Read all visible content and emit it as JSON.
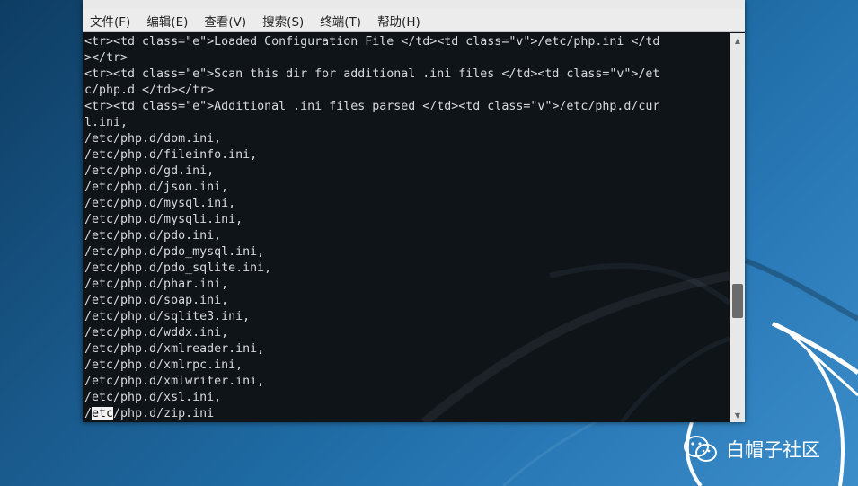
{
  "menubar": {
    "items": [
      "文件(F)",
      "编辑(E)",
      "查看(V)",
      "搜索(S)",
      "终端(T)",
      "帮助(H)"
    ]
  },
  "terminal": {
    "lines": [
      "<tr><td class=\"e\">Loaded Configuration File </td><td class=\"v\">/etc/php.ini </td",
      "></tr>",
      "<tr><td class=\"e\">Scan this dir for additional .ini files </td><td class=\"v\">/et",
      "c/php.d </td></tr>",
      "<tr><td class=\"e\">Additional .ini files parsed </td><td class=\"v\">/etc/php.d/cur",
      "l.ini,",
      "/etc/php.d/dom.ini,",
      "/etc/php.d/fileinfo.ini,",
      "/etc/php.d/gd.ini,",
      "/etc/php.d/json.ini,",
      "/etc/php.d/mysql.ini,",
      "/etc/php.d/mysqli.ini,",
      "/etc/php.d/pdo.ini,",
      "/etc/php.d/pdo_mysql.ini,",
      "/etc/php.d/pdo_sqlite.ini,",
      "/etc/php.d/phar.ini,",
      "/etc/php.d/soap.ini,",
      "/etc/php.d/sqlite3.ini,",
      "/etc/php.d/wddx.ini,",
      "/etc/php.d/xmlreader.ini,",
      "/etc/php.d/xmlrpc.ini,",
      "/etc/php.d/xmlwriter.ini,",
      "/etc/php.d/xsl.ini,"
    ],
    "last_line": {
      "before": "/",
      "selected": "etc",
      "after": "/php.d/zip.ini"
    }
  },
  "icons": {
    "scroll_up": "scroll-up-arrow-icon",
    "scroll_down": "scroll-down-arrow-icon",
    "wechat": "wechat-icon"
  },
  "watermark": {
    "text": "白帽子社区"
  },
  "colors": {
    "terminal_bg": "#0f1419",
    "terminal_fg": "#d7dadc",
    "desktop": "#1e6aa3"
  }
}
